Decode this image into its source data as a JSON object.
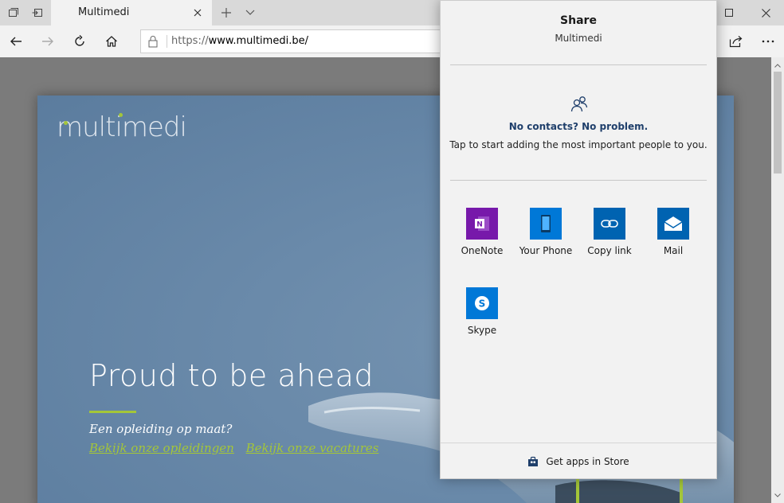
{
  "browser": {
    "tab_title": "Multimedi",
    "url_scheme": "https://",
    "url_host": "www.multimedi.be/"
  },
  "page": {
    "logo_text": "multimedi",
    "headline": "Proud to be ahead",
    "subline": "Een opleiding op maat?",
    "link_trainings": "Bekijk onze opleidingen",
    "link_vacancies": "Bekijk onze vacatures",
    "accent_color": "#a4c639"
  },
  "share": {
    "title": "Share",
    "subtitle": "Multimedi",
    "contacts_heading": "No contacts? No problem.",
    "contacts_desc": "Tap to start adding the most important people to you.",
    "apps": [
      {
        "label": "OneNote",
        "icon": "onenote-icon",
        "color": "#7719aa"
      },
      {
        "label": "Your Phone",
        "icon": "phone-icon",
        "color": "#0078d7"
      },
      {
        "label": "Copy link",
        "icon": "link-icon",
        "color": "#0063b1"
      },
      {
        "label": "Mail",
        "icon": "mail-icon",
        "color": "#0063b1"
      },
      {
        "label": "Skype",
        "icon": "skype-icon",
        "color": "#0078d7"
      }
    ],
    "store_label": "Get apps in Store"
  }
}
